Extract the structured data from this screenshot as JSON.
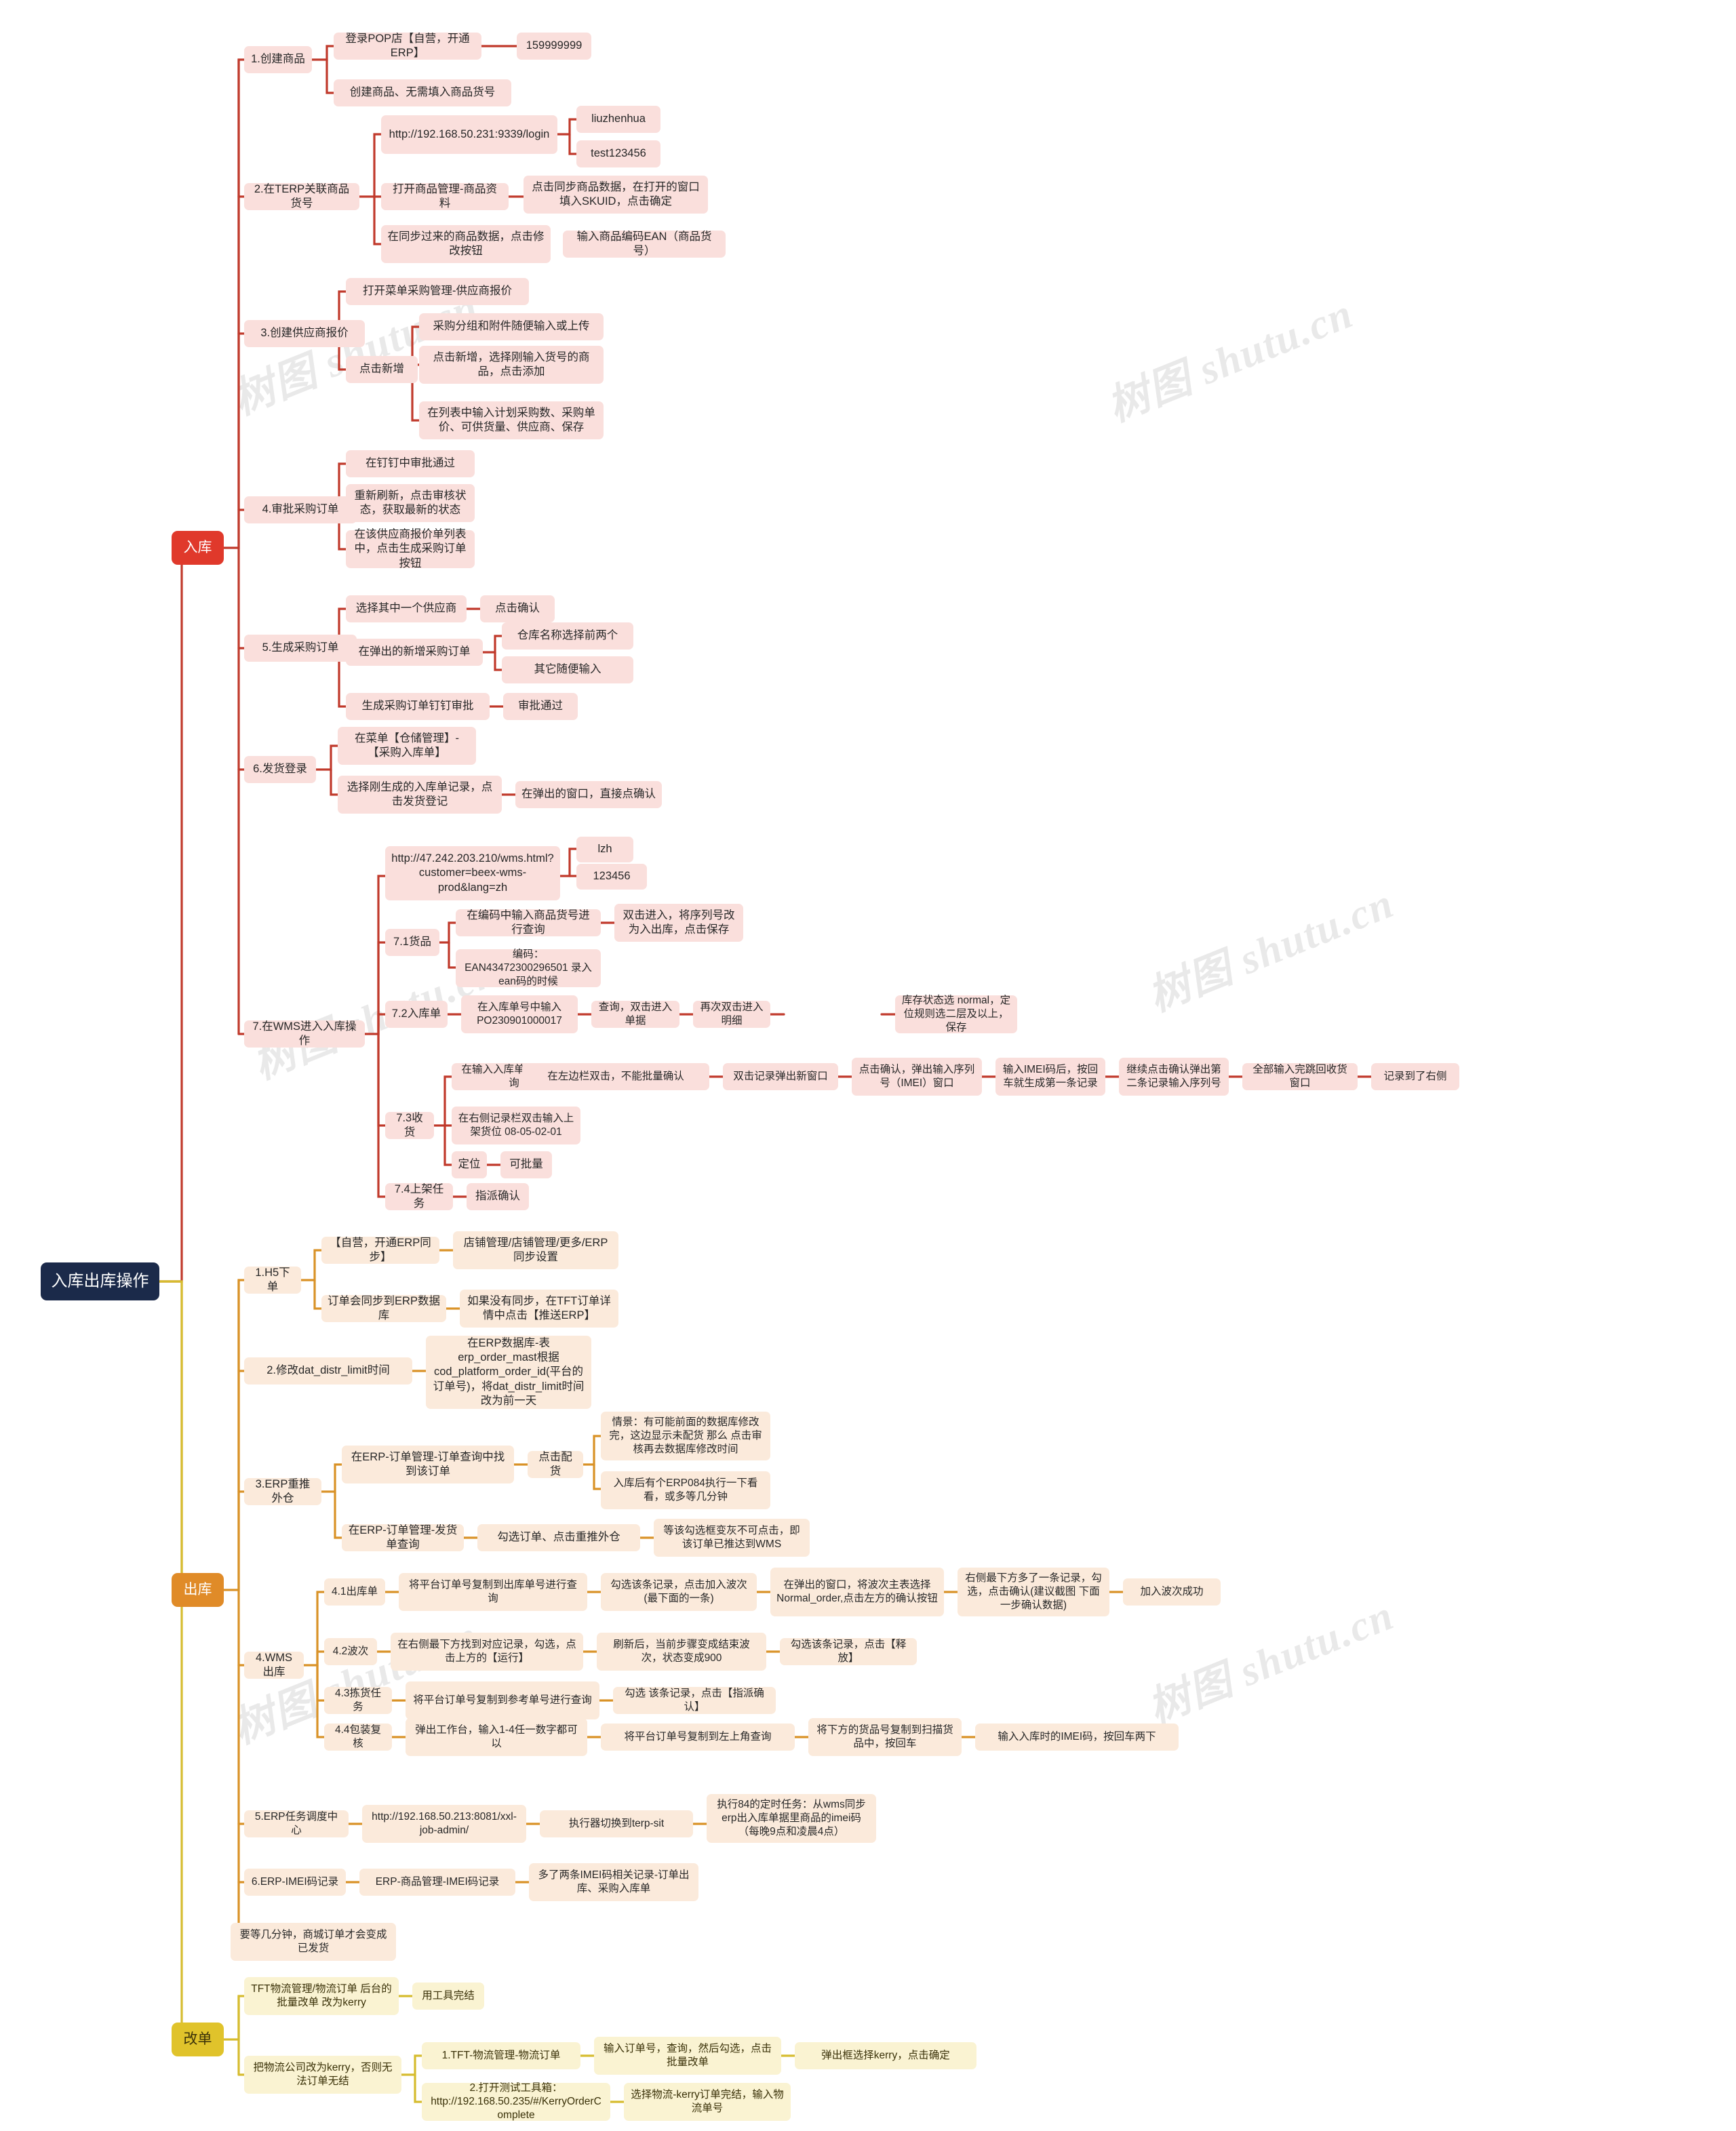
{
  "title": "入库出库操作 思维导图",
  "root": {
    "label": "入库出库操作"
  },
  "watermarks": [
    "树图 shutu.cn",
    "树图 shutu.cn",
    "树图 shutu.cn",
    "树图 shutu.cn",
    "树图 shutu.cn",
    "树图 shutu.cn"
  ],
  "colors": {
    "root_bg": "#1b2a4a",
    "inbound_accent": "#e0392b",
    "inbound_node": "#fadfdc",
    "outbound_accent": "#e08b28",
    "outbound_node": "#fbeadb",
    "change_accent": "#e0c32b",
    "change_node": "#faf3d2",
    "page_bg": "#ffffff"
  },
  "branches": {
    "inbound": {
      "label": "入库"
    },
    "outbound": {
      "label": "出库"
    },
    "change": {
      "label": "改单"
    }
  },
  "nodes": {
    "n1": "1.创建商品",
    "n1a": "登录POP店【自营，开通ERP】",
    "n1a1": "159999999",
    "n1b": "创建商品、无需填入商品货号",
    "n2": "2.在TERP关联商品货号",
    "n2a": "http://192.168.50.231:9339/login",
    "n2a1": "liuzhenhua",
    "n2a2": "test123456",
    "n2b": "打开商品管理-商品资料",
    "n2b1": "点击同步商品数据，在打开的窗口填入SKUID，点击确定",
    "n2c": "在同步过来的商品数据，点击修改按钮",
    "n2c1": "输入商品编码EAN（商品货号）",
    "n3": "3.创建供应商报价",
    "n3a": "打开菜单采购管理-供应商报价",
    "n3b": "点击新增",
    "n3b1": "采购分组和附件随便输入或上传",
    "n3b2": "点击新增，选择刚输入货号的商品，点击添加",
    "n3b3": "在列表中输入计划采购数、采购单价、可供货量、供应商、保存",
    "n4": "4.审批采购订单",
    "n4a": "在钉钉中审批通过",
    "n4b": "重新刷新，点击审核状态，获取最新的状态",
    "n4c": "在该供应商报价单列表中，点击生成采购订单按钮",
    "n5": "5.生成采购订单",
    "n5a": "选择其中一个供应商",
    "n5a1": "点击确认",
    "n5b": "在弹出的新增采购订单",
    "n5b1": "仓库名称选择前两个",
    "n5b2": "其它随便输入",
    "n5c": "生成采购订单钉钉审批",
    "n5c1": "审批通过",
    "n6": "6.发货登录",
    "n6a": "在菜单【仓储管理】-【采购入库单】",
    "n6b": "选择刚生成的入库单记录，点击发货登记",
    "n6b1": "在弹出的窗口，直接点确认",
    "n7": "7.在WMS进入入库操作",
    "n7a": "http://47.242.203.210/wms.html?customer=beex-wms-prod&lang=zh",
    "n7a1": "lzh",
    "n7a2": "123456",
    "n71": "7.1货品",
    "n71a": "在编码中输入商品货号进行查询",
    "n71a1": "双击进入，将序列号改为入出库，点击保存",
    "n71b": "编码：EAN43472300296501 录入ean码的时候",
    "n72": "7.2入库单",
    "n72a": "在入库单号中输入PO230901000017",
    "n72a1": "查询，双击进入单据",
    "n72a2": "再次双击进入明细",
    "n72a3": "库存状态选 normal，定位规则选二层及以上，保存",
    "n73": "7.3收货",
    "n73a": "在输入入库单单号、查询",
    "n73a1": "在左边栏双击，不能批量确认",
    "n73a2": "双击记录弹出新窗口",
    "n73a3": "点击确认，弹出输入序列号（IMEI）窗口",
    "n73a4": "输入IMEI码后，按回车就生成第一条记录",
    "n73a5": "继续点击确认弹出第二条记录输入序列号",
    "n73a6": "全部输入完跳回收货窗口",
    "n73a7": "记录到了右侧",
    "n73b": "在右侧记录栏双击输入上架货位 08-05-02-01",
    "n73c": "定位",
    "n73c1": "可批量",
    "n74": "7.4上架任务",
    "n74a": "指派确认",
    "o1": "1.H5下单",
    "o1a": "【自营，开通ERP同步】",
    "o1a1": "店铺管理/店铺管理/更多/ERP同步设置",
    "o1b": "订单会同步到ERP数据库",
    "o1b1": "如果没有同步，在TFT订单详情中点击【推送ERP】",
    "o2": "2.修改dat_distr_limit时间",
    "o2a": "在ERP数据库-表erp_order_mast根据cod_platform_order_id(平台的订单号)，将dat_distr_limit时间改为前一天",
    "o3": "3.ERP重推外仓",
    "o3a": "在ERP-订单管理-订单查询中找到该订单",
    "o3a1": "点击配货",
    "o3a1a": "情景：有可能前面的数据库修改完，这边显示未配货 那么 点击审核再去数据库修改时间",
    "o3a1b": "入库后有个ERP084执行一下看看，或多等几分钟",
    "o3b": "在ERP-订单管理-发货单查询",
    "o3b1": "勾选订单、点击重推外仓",
    "o3b2": "等该勾选框变灰不可点击，即该订单已推达到WMS",
    "o4": "4.WMS出库",
    "o41": "4.1出库单",
    "o41a": "将平台订单号复制到出库单号进行查询",
    "o41a1": "勾选该条记录，点击加入波次(最下面的一条)",
    "o41a2": "在弹出的窗口，将波次主表选择Normal_order,点击左方的确认按钮",
    "o41a3": "右侧最下方多了一条记录，勾选，点击确认(建议截图 下面一步确认数据)",
    "o41a4": "加入波次成功",
    "o42": "4.2波次",
    "o42a": "在右侧最下方找到对应记录，勾选，点击上方的【运行】",
    "o42a1": "刷新后，当前步骤变成结束波次，状态变成900",
    "o42a2": "勾选该条记录，点击【释放】",
    "o43": "4.3拣货任务",
    "o43a": "将平台订单号复制到参考单号进行查询",
    "o43a1": "勾选 该条记录，点击【指派确认】",
    "o44": "4.4包装复核",
    "o44a": "弹出工作台，输入1-4任一数字都可以",
    "o44a1": "将平台订单号复制到左上角查询",
    "o44a2": "将下方的货品号复制到扫描货品中，按回车",
    "o44a3": "输入入库时的IMEI码，按回车两下",
    "o5": "5.ERP任务调度中心",
    "o5a": "http://192.168.50.213:8081/xxl-job-admin/",
    "o5a1": "执行器切换到terp-sit",
    "o5a2": "执行84的定时任务：从wms同步erp出入库单据里商品的imei码（每晚9点和凌晨4点）",
    "o6": "6.ERP-IMEI码记录",
    "o6a": "ERP-商品管理-IMEI码记录",
    "o6a1": "多了两条IMEI码相关记录-订单出库、采购入库单",
    "o7": "要等几分钟，商城订单才会变成已发货",
    "c1": "TFT物流管理/物流订单 后台的批量改单 改为kerry",
    "c1a": "用工具完结",
    "c2": "把物流公司改为kerry，否则无法订单无结",
    "c2a": "1.TFT-物流管理-物流订单",
    "c2a1": "输入订单号，查询，然后勾选，点击批量改单",
    "c2a2": "弹出框选择kerry，点击确定",
    "c2b": "2.打开测试工具箱：http://192.168.50.235/#/KerryOrderComplete",
    "c2b1": "选择物流-kerry订单完结，输入物流单号"
  }
}
